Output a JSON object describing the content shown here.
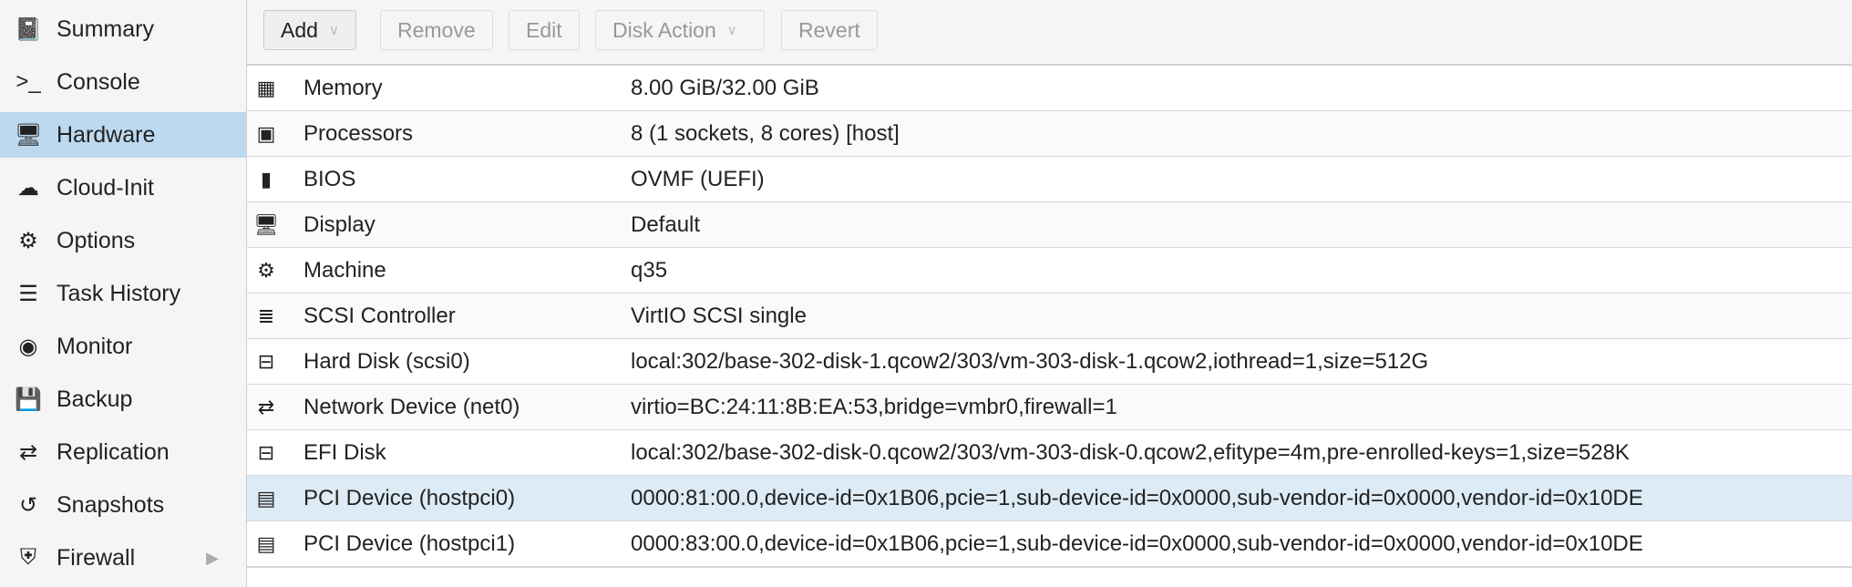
{
  "sidebar": {
    "items": [
      {
        "label": "Summary",
        "icon": "book-icon",
        "glyph": "📓"
      },
      {
        "label": "Console",
        "icon": "terminal-icon",
        "glyph": ">_"
      },
      {
        "label": "Hardware",
        "icon": "desktop-icon",
        "glyph": "🖥",
        "selected": true
      },
      {
        "label": "Cloud-Init",
        "icon": "cloud-icon",
        "glyph": "☁"
      },
      {
        "label": "Options",
        "icon": "gear-icon",
        "glyph": "⚙"
      },
      {
        "label": "Task History",
        "icon": "list-icon",
        "glyph": "☰"
      },
      {
        "label": "Monitor",
        "icon": "eye-icon",
        "glyph": "◉"
      },
      {
        "label": "Backup",
        "icon": "floppy-icon",
        "glyph": "💾"
      },
      {
        "label": "Replication",
        "icon": "retweet-icon",
        "glyph": "⇄"
      },
      {
        "label": "Snapshots",
        "icon": "history-icon",
        "glyph": "↺"
      },
      {
        "label": "Firewall",
        "icon": "shield-icon",
        "glyph": "⛨"
      }
    ]
  },
  "toolbar": {
    "add": "Add",
    "remove": "Remove",
    "edit": "Edit",
    "disk_action": "Disk Action",
    "revert": "Revert"
  },
  "hardware": [
    {
      "key": "Memory",
      "value": "8.00 GiB/32.00 GiB",
      "icon": "memory-icon",
      "glyph": "▦"
    },
    {
      "key": "Processors",
      "value": "8 (1 sockets, 8 cores) [host]",
      "icon": "cpu-icon",
      "glyph": "▣"
    },
    {
      "key": "BIOS",
      "value": "OVMF (UEFI)",
      "icon": "chip-icon",
      "glyph": "▮"
    },
    {
      "key": "Display",
      "value": "Default",
      "icon": "desktop-icon",
      "glyph": "🖥"
    },
    {
      "key": "Machine",
      "value": "q35",
      "icon": "cogs-icon",
      "glyph": "⚙"
    },
    {
      "key": "SCSI Controller",
      "value": "VirtIO SCSI single",
      "icon": "database-icon",
      "glyph": "≣"
    },
    {
      "key": "Hard Disk (scsi0)",
      "value": "local:302/base-302-disk-1.qcow2/303/vm-303-disk-1.qcow2,iothread=1,size=512G",
      "icon": "hdd-icon",
      "glyph": "⊟"
    },
    {
      "key": "Network Device (net0)",
      "value": "virtio=BC:24:11:8B:EA:53,bridge=vmbr0,firewall=1",
      "icon": "exchange-icon",
      "glyph": "⇄"
    },
    {
      "key": "EFI Disk",
      "value": "local:302/base-302-disk-0.qcow2/303/vm-303-disk-0.qcow2,efitype=4m,pre-enrolled-keys=1,size=528K",
      "icon": "hdd-icon",
      "glyph": "⊟"
    },
    {
      "key": "PCI Device (hostpci0)",
      "value": "0000:81:00.0,device-id=0x1B06,pcie=1,sub-device-id=0x0000,sub-vendor-id=0x0000,vendor-id=0x10DE",
      "icon": "pci-card-icon",
      "glyph": "▤",
      "selected": true
    },
    {
      "key": "PCI Device (hostpci1)",
      "value": "0000:83:00.0,device-id=0x1B06,pcie=1,sub-device-id=0x0000,sub-vendor-id=0x0000,vendor-id=0x10DE",
      "icon": "pci-card-icon",
      "glyph": "▤"
    }
  ]
}
